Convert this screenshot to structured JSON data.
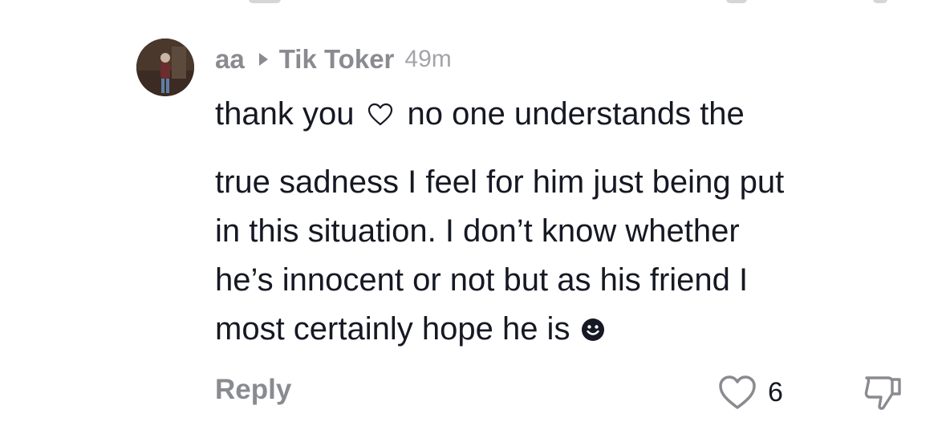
{
  "comment": {
    "username": "aa",
    "reply_target": "Tik Toker",
    "timestamp": "49m",
    "first_line": "thank you",
    "first_line_rest": "no one understands the",
    "paragraph_lines": [
      "true sadness I feel for him just being put",
      "in this situation. I don’t know whether",
      "he’s innocent or not but as his friend I",
      "most certainly hope he is"
    ],
    "inline_icons": [
      "heart-outline-icon",
      "smiling-face-emoji-icon"
    ],
    "reply_label": "Reply",
    "like_count": "6",
    "actions": {
      "like_icon": "heart-outline-icon",
      "dislike_icon": "thumbs-down-icon"
    }
  },
  "colors": {
    "text": "#161823",
    "muted": "#8a8b91",
    "timestamp": "#a3a4a8"
  }
}
